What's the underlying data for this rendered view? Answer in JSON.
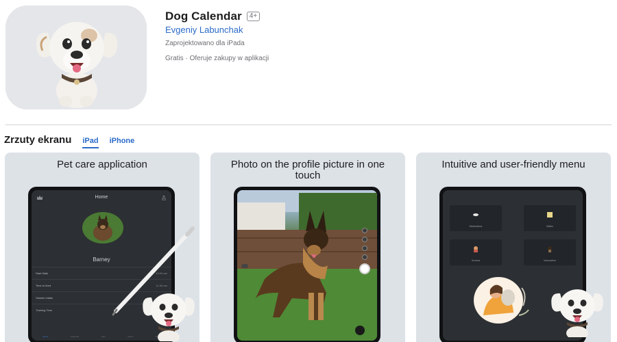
{
  "app": {
    "title": "Dog Calendar",
    "age_rating": "4+",
    "developer": "Evgeniy Labunchak",
    "designed_for": "Zaprojektowano dla iPada",
    "price": "Gratis",
    "separator": "·",
    "purchases": "Oferuje zakupy w aplikacji",
    "icon": "dog-mascot-icon"
  },
  "screenshots": {
    "title": "Zrzuty ekranu",
    "tabs": [
      {
        "label": "iPad",
        "active": true
      },
      {
        "label": "iPhone",
        "active": false
      }
    ],
    "cards": [
      {
        "caption": "Pet care application",
        "screen": {
          "header": "Home",
          "pet_name": "Barney",
          "rows": [
            {
              "label": "Start Walk",
              "time": "10:00 am"
            },
            {
              "label": "Time to feed",
              "time": "11:30 am"
            },
            {
              "label": "Vitamin Intake",
              "time": ""
            },
            {
              "label": "Training Time",
              "time": ""
            }
          ],
          "tabbar": [
            "Home",
            "Calendar",
            "Pets",
            "Notes",
            "More"
          ]
        }
      },
      {
        "caption": "Photo on the profile picture in one touch"
      },
      {
        "caption": "Intuitive and user-friendly menu",
        "screen": {
          "tiles": [
            "Medications",
            "Walks",
            "Grooms",
            "Information"
          ]
        }
      }
    ]
  },
  "colors": {
    "link": "#2a6ac8",
    "card_bg": "#dde2e7",
    "screen_bg": "#2c2f33"
  }
}
